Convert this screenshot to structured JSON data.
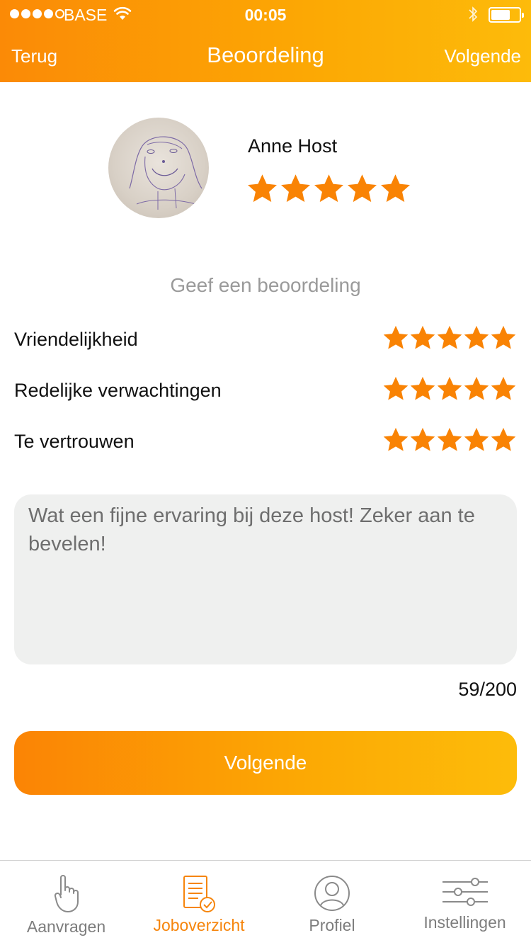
{
  "status_bar": {
    "carrier": "BASE",
    "time": "00:05",
    "signal_bars": 4,
    "signal_total": 5
  },
  "nav": {
    "back": "Terug",
    "title": "Beoordeling",
    "next": "Volgende"
  },
  "host": {
    "name": "Anne Host",
    "stars": 5
  },
  "rating": {
    "title": "Geef een beoordeling",
    "items": [
      {
        "label": "Vriendelijkheid",
        "stars": 5
      },
      {
        "label": "Redelijke verwachtingen",
        "stars": 5
      },
      {
        "label": "Te vertrouwen",
        "stars": 5
      }
    ]
  },
  "comment": {
    "text": "Wat een fijne ervaring bij deze host! Zeker aan te bevelen!",
    "counter": "59/200"
  },
  "cta": {
    "label": "Volgende"
  },
  "tabs": [
    {
      "label": "Aanvragen",
      "icon": "hand-pointing-icon",
      "active": false
    },
    {
      "label": "Joboverzicht",
      "icon": "document-check-icon",
      "active": true
    },
    {
      "label": "Profiel",
      "icon": "person-icon",
      "active": false
    },
    {
      "label": "Instellingen",
      "icon": "sliders-icon",
      "active": false
    }
  ],
  "colors": {
    "accent": "#f6850c",
    "star": "#f98304",
    "comment_bg": "#eff0ef"
  }
}
